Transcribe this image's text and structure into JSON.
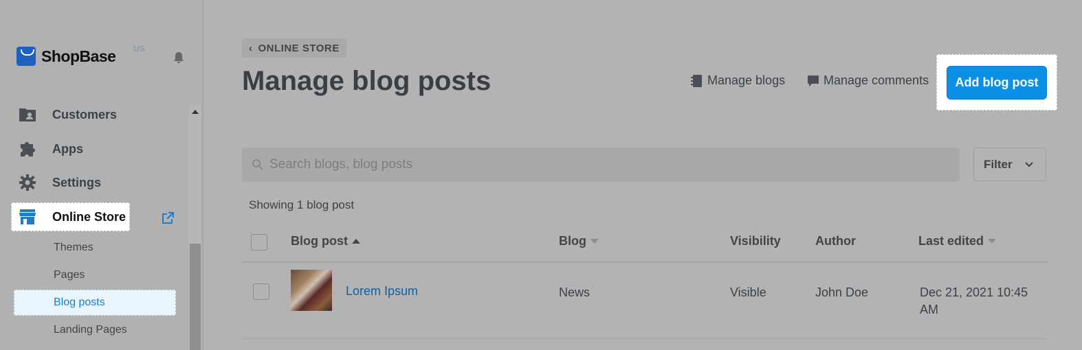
{
  "sidebar": {
    "logo_text": "ShopBase",
    "logo_region": "US",
    "nav": [
      {
        "label": "Customers",
        "icon": "customers-icon"
      },
      {
        "label": "Apps",
        "icon": "puzzle-icon"
      },
      {
        "label": "Settings",
        "icon": "gear-icon"
      },
      {
        "label": "Online Store",
        "icon": "store-icon"
      }
    ],
    "sub_items": [
      "Themes",
      "Pages",
      "Blog posts",
      "Landing Pages"
    ],
    "active_sub": "Blog posts"
  },
  "header": {
    "breadcrumb": "ONLINE STORE",
    "title": "Manage blog posts",
    "manage_blogs": "Manage blogs",
    "manage_comments": "Manage comments",
    "add_button": "Add blog post"
  },
  "search": {
    "placeholder": "Search blogs, blog posts"
  },
  "filter_label": "Filter",
  "count_text": "Showing 1 blog post",
  "table": {
    "columns": [
      "Blog post",
      "Blog",
      "Visibility",
      "Author",
      "Last edited"
    ],
    "rows": [
      {
        "title": "Lorem Ipsum",
        "blog": "News",
        "visibility": "Visible",
        "author": "John Doe",
        "last_edited_line1": "Dec 21, 2021 10:45",
        "last_edited_line2": "AM"
      }
    ]
  },
  "colors": {
    "accent": "#0c8fe6",
    "link": "#0b62a3",
    "overlay": "#b3b3b3"
  }
}
